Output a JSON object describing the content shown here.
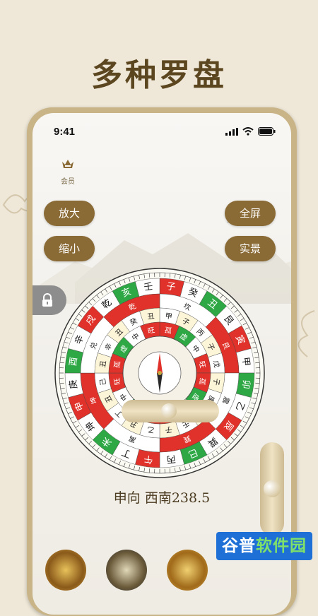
{
  "page": {
    "headline": "多种罗盘"
  },
  "status_bar": {
    "time": "9:41"
  },
  "app": {
    "vip_label": "会员",
    "buttons": {
      "zoom_in": "放大",
      "zoom_out": "缩小",
      "fullscreen": "全屏",
      "live_view": "实景"
    },
    "direction_text": "申向 西南238.5",
    "heading_degrees": 238.5
  },
  "compass": {
    "rings": [
      {
        "labels": [
          "子",
          "癸",
          "丑",
          "艮",
          "寅",
          "甲",
          "卯",
          "乙",
          "辰",
          "巽",
          "巳",
          "丙",
          "午",
          "丁",
          "未",
          "坤",
          "申",
          "庚",
          "酉",
          "辛",
          "戌",
          "乾",
          "亥",
          "壬"
        ]
      },
      {
        "labels": [
          "坎",
          "艮",
          "震",
          "巽",
          "离",
          "坤",
          "兑",
          "乾"
        ]
      },
      {
        "labels": [
          "甲",
          "子",
          "丙",
          "子",
          "戊",
          "子",
          "庚",
          "子",
          "壬",
          "子",
          "乙",
          "丑",
          "丁",
          "丑",
          "己",
          "丑",
          "辛",
          "丑",
          "癸",
          "丑"
        ]
      },
      {
        "labels": [
          "孤",
          "虚",
          "中",
          "旺",
          "孤",
          "虚",
          "中",
          "旺",
          "孤",
          "虚",
          "中",
          "旺",
          "孤",
          "虚",
          "中",
          "旺"
        ]
      }
    ],
    "colors": {
      "red": "#e0322a",
      "green": "#2ea845",
      "gold": "#c9a43c",
      "black": "#1a1a1a"
    }
  },
  "watermark": {
    "part1": "谷普",
    "part2": "软件园"
  }
}
